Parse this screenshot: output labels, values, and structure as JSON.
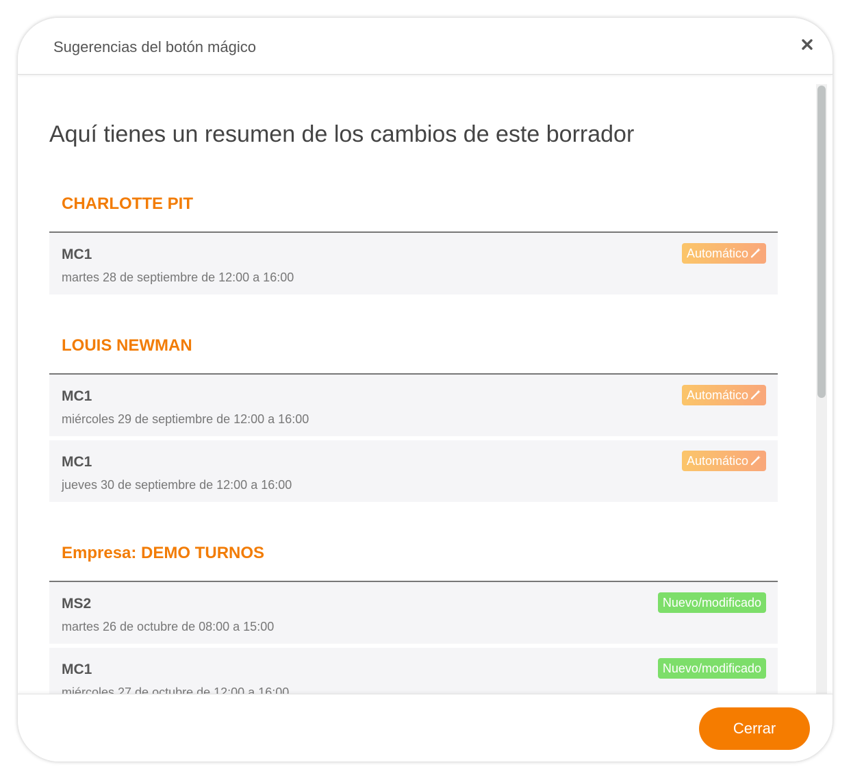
{
  "header": {
    "title": "Sugerencias del botón mágico",
    "close_icon": "close-icon"
  },
  "body": {
    "summary_title": "Aquí tienes un resumen de los cambios de este borrador",
    "groups": [
      {
        "heading": "CHARLOTTE PIT",
        "items": [
          {
            "code": "MC1",
            "date": "martes 28 de septiembre de 12:00 a 16:00",
            "badge": "Automático",
            "badge_icon": "magic-wand-icon"
          }
        ]
      },
      {
        "heading": "LOUIS NEWMAN",
        "items": [
          {
            "code": "MC1",
            "date": "miércoles 29 de septiembre de 12:00 a 16:00",
            "badge": "Automático",
            "badge_icon": "magic-wand-icon"
          },
          {
            "code": "MC1",
            "date": "jueves 30 de septiembre de 12:00 a 16:00",
            "badge": "Automático",
            "badge_icon": "magic-wand-icon"
          }
        ]
      },
      {
        "heading": "Empresa: DEMO TURNOS",
        "items": [
          {
            "code": "MS2",
            "date": "martes 26 de octubre de 08:00 a 15:00",
            "badge": "Nuevo/modificado"
          },
          {
            "code": "MC1",
            "date": "miércoles 27 de octubre de 12:00 a 16:00",
            "badge": "Nuevo/modificado"
          }
        ]
      }
    ]
  },
  "footer": {
    "close_label": "Cerrar"
  },
  "colors": {
    "accent": "#f57c00",
    "heading": "#f27c06",
    "badge_auto": "#fbc56a",
    "badge_new": "#7dde6a"
  }
}
